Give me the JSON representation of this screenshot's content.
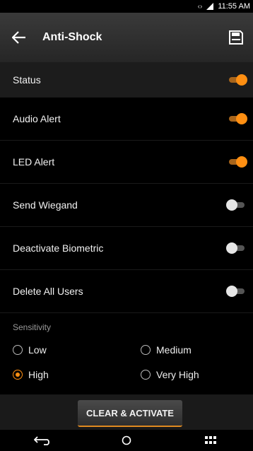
{
  "status_bar": {
    "time": "11:55 AM"
  },
  "toolbar": {
    "title": "Anti-Shock"
  },
  "toggles": [
    {
      "label": "Status",
      "on": true
    },
    {
      "label": "Audio Alert",
      "on": true
    },
    {
      "label": "LED Alert",
      "on": true
    },
    {
      "label": "Send Wiegand",
      "on": false
    },
    {
      "label": "Deactivate Biometric",
      "on": false
    },
    {
      "label": "Delete All Users",
      "on": false
    }
  ],
  "sensitivity": {
    "label": "Sensitivity",
    "options": [
      "Low",
      "Medium",
      "High",
      "Very High"
    ],
    "selected": "High"
  },
  "actions": {
    "activate_label": "CLEAR & ACTIVATE"
  },
  "colors": {
    "accent": "#ff8f12",
    "background": "#000000",
    "toolbar": "#2f2f2f"
  },
  "icons": {
    "back": "arrow-left-icon",
    "save": "save-icon",
    "nav": [
      "back-nav-icon",
      "home-nav-icon",
      "apps-nav-icon"
    ]
  }
}
